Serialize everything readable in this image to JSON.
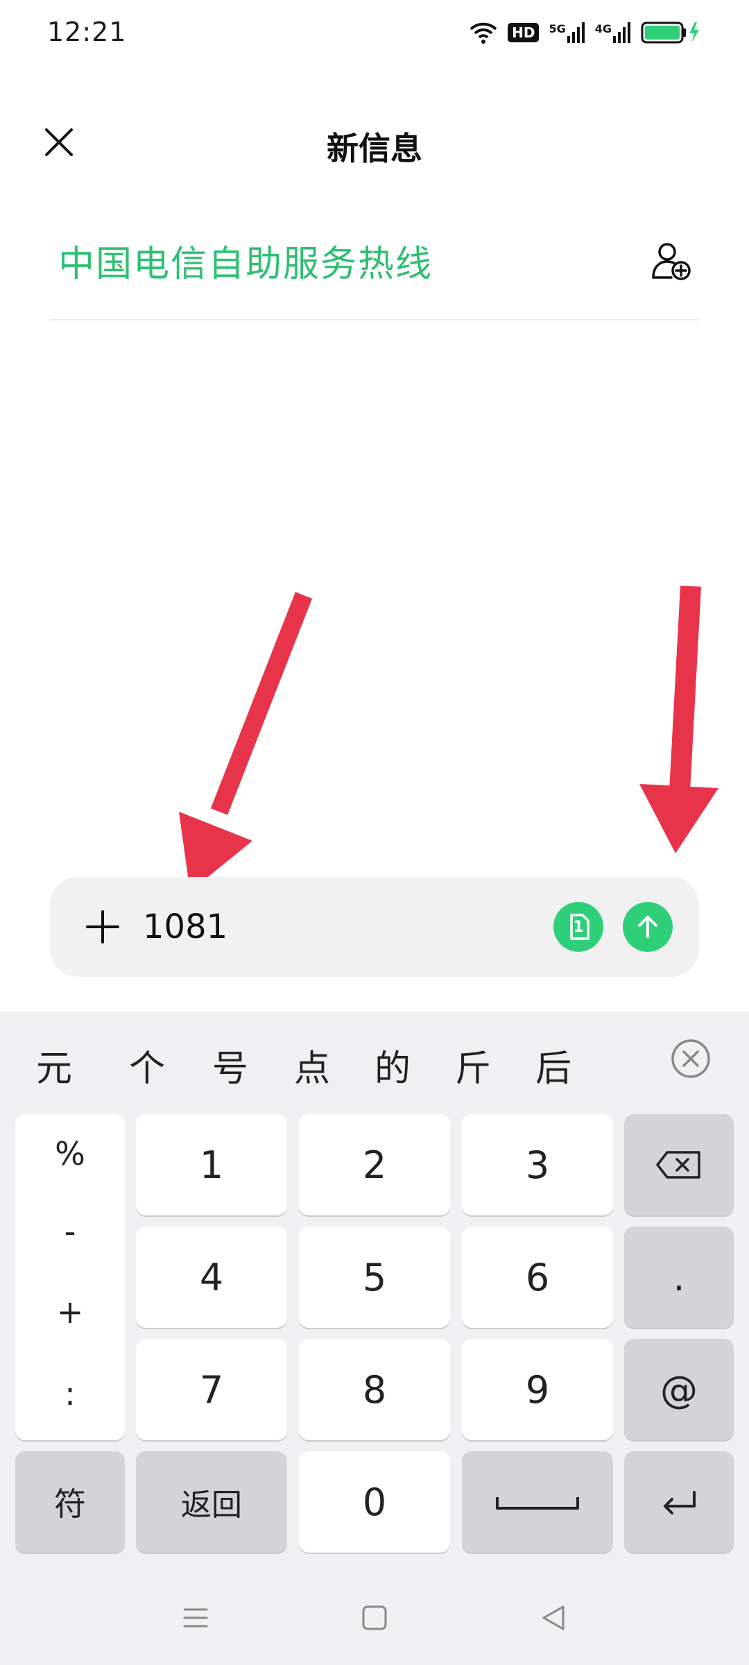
{
  "status_bar": {
    "time": "12:21",
    "network_5g": "5G",
    "network_4g": "4G",
    "hd_label": "HD"
  },
  "header": {
    "title": "新信息"
  },
  "recipient": {
    "name": "中国电信自助服务热线"
  },
  "compose": {
    "text": "1081",
    "sim_label": "1"
  },
  "keyboard": {
    "candidates": [
      "元",
      "个",
      "号",
      "点",
      "的",
      "斤",
      "后"
    ],
    "symbols": [
      "%",
      "-",
      "+",
      ":"
    ],
    "digits": [
      "1",
      "2",
      "3",
      "4",
      "5",
      "6",
      "7",
      "8",
      "9",
      "0"
    ],
    "dot": ".",
    "at": "@",
    "symbol_key": "符",
    "back_key": "返回"
  },
  "colors": {
    "accent": "#2fcf7a",
    "recipient_text": "#2fbf71",
    "arrow": "#e8344a"
  }
}
